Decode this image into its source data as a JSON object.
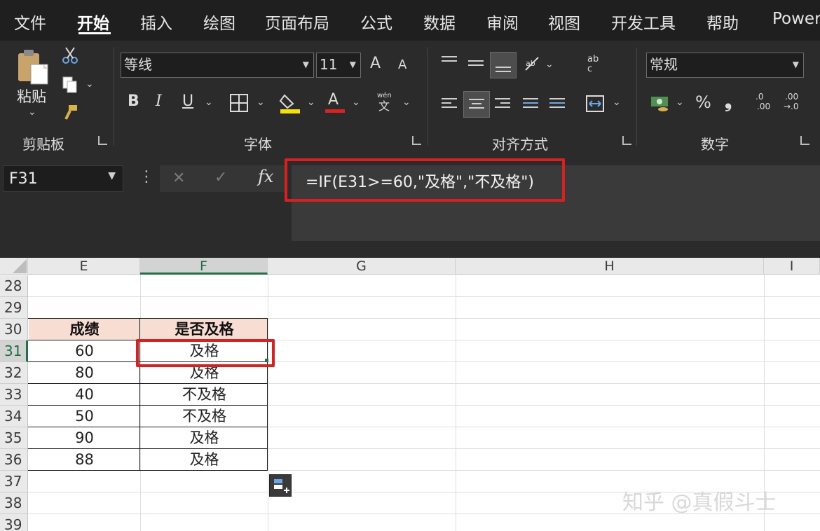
{
  "menu": {
    "tabs": [
      {
        "label": "文件"
      },
      {
        "label": "开始"
      },
      {
        "label": "插入"
      },
      {
        "label": "绘图"
      },
      {
        "label": "页面布局"
      },
      {
        "label": "公式"
      },
      {
        "label": "数据"
      },
      {
        "label": "审阅"
      },
      {
        "label": "视图"
      },
      {
        "label": "开发工具"
      },
      {
        "label": "帮助"
      },
      {
        "label": "Power"
      }
    ],
    "active_tab": "开始"
  },
  "ribbon": {
    "clipboard": {
      "paste_label": "粘贴",
      "group_label": "剪贴板"
    },
    "font": {
      "font_name": "等线",
      "font_size": "11",
      "bold": "B",
      "italic": "I",
      "underline": "U",
      "font_color_glyph": "A",
      "phonetic_top": "wén",
      "phonetic_bottom": "文",
      "grow": "A",
      "shrink": "A",
      "group_label": "字体"
    },
    "alignment": {
      "wrap_top": "ab",
      "wrap_bottom": "c",
      "group_label": "对齐方式"
    },
    "number": {
      "format": "常规",
      "percent": "%",
      "comma": "❟",
      "inc_top": ".0",
      "inc_bottom": ".00",
      "dec_top": ".00",
      "dec_bottom": "→.0",
      "group_label": "数字"
    }
  },
  "formula_bar": {
    "name_box": "F31",
    "cancel": "✕",
    "confirm": "✓",
    "fx": "fx",
    "formula": "=IF(E31>=60,\"及格\",\"不及格\")"
  },
  "sheet": {
    "columns": [
      "E",
      "F",
      "G",
      "H",
      "I"
    ],
    "selected_column": "F",
    "rows": [
      "28",
      "29",
      "30",
      "31",
      "32",
      "33",
      "34",
      "35",
      "36",
      "37",
      "38",
      "39"
    ],
    "selected_row": "31",
    "table_header": {
      "score": "成绩",
      "pass": "是否及格"
    },
    "table_rows": [
      {
        "score": "60",
        "pass": "及格"
      },
      {
        "score": "80",
        "pass": "及格"
      },
      {
        "score": "40",
        "pass": "不及格"
      },
      {
        "score": "50",
        "pass": "不及格"
      },
      {
        "score": "90",
        "pass": "及格"
      },
      {
        "score": "88",
        "pass": "及格"
      }
    ]
  },
  "watermark": "知乎 @真假斗士",
  "colors": {
    "accent_red": "#d9201f",
    "excel_green": "#217346",
    "header_fill": "#f8ddd2"
  }
}
